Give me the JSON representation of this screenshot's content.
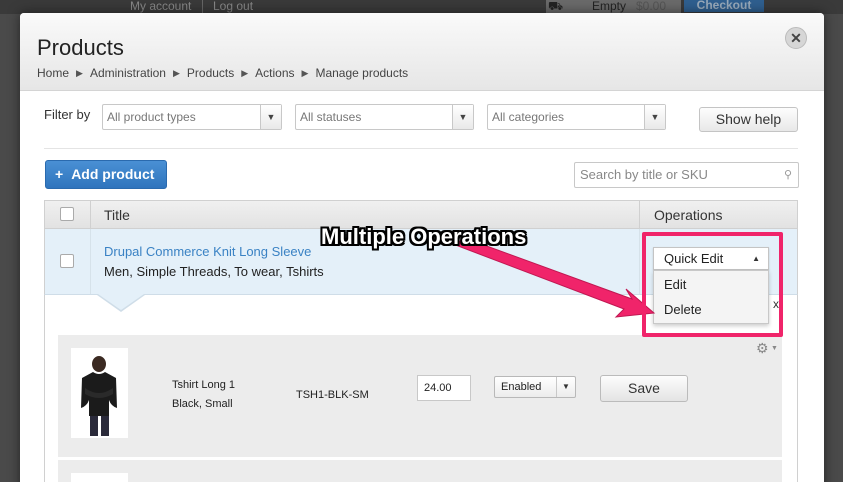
{
  "background": {
    "my_account": "My account",
    "log_out": "Log out",
    "cart_empty": "Empty",
    "cart_total": "$0.00",
    "checkout": "Checkout"
  },
  "modal": {
    "title": "Products",
    "close_icon": "close-icon",
    "breadcrumb": [
      "Home",
      "Administration",
      "Products",
      "Actions",
      "Manage products"
    ]
  },
  "filters": {
    "label": "Filter by",
    "product_types": "All product types",
    "statuses": "All statuses",
    "categories": "All categories",
    "show_help": "Show help"
  },
  "toolbar": {
    "add_product": "Add product",
    "search_placeholder": "Search by title or SKU"
  },
  "table": {
    "headers": {
      "title": "Title",
      "operations": "Operations"
    },
    "row": {
      "title": "Drupal Commerce Knit Long Sleeve",
      "tags": "Men, Simple Threads, To wear, Tshirts"
    },
    "operations_menu": {
      "selected": "Quick Edit",
      "items": [
        "Edit",
        "Delete"
      ]
    }
  },
  "variant": {
    "name": "Tshirt Long 1",
    "attributes": "Black, Small",
    "sku": "TSH1-BLK-SM",
    "price": "24.00",
    "status": "Enabled",
    "save": "Save",
    "close": "x"
  },
  "annotation": {
    "label": "Multiple Operations",
    "color": "#f0246a"
  },
  "colors": {
    "accent": "#3a82c4",
    "selected_row": "#e4f0f9"
  }
}
